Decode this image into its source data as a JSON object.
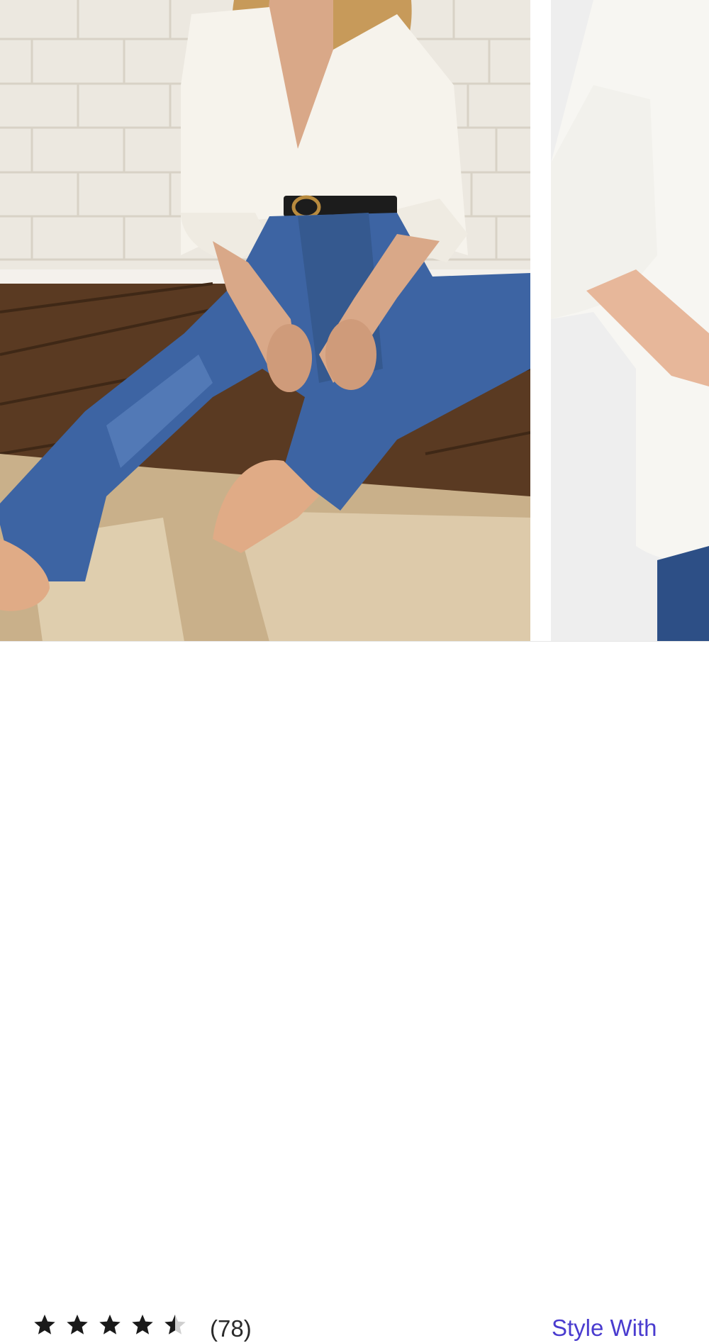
{
  "gallery": {
    "images": [
      {
        "alt": ""
      },
      {
        "alt": ""
      }
    ]
  },
  "rating": {
    "value": 4.5,
    "max": 5,
    "icons": [
      "star-full-icon",
      "star-full-icon",
      "star-full-icon",
      "star-full-icon",
      "star-half-icon"
    ],
    "count_label": "(78)"
  },
  "actions": {
    "style_with_label": "Style With"
  },
  "colors": {
    "star": "#1a1a1a",
    "star_empty": "#cfcfcf",
    "link": "#4a3ccf",
    "text": "#2a2a2a"
  }
}
